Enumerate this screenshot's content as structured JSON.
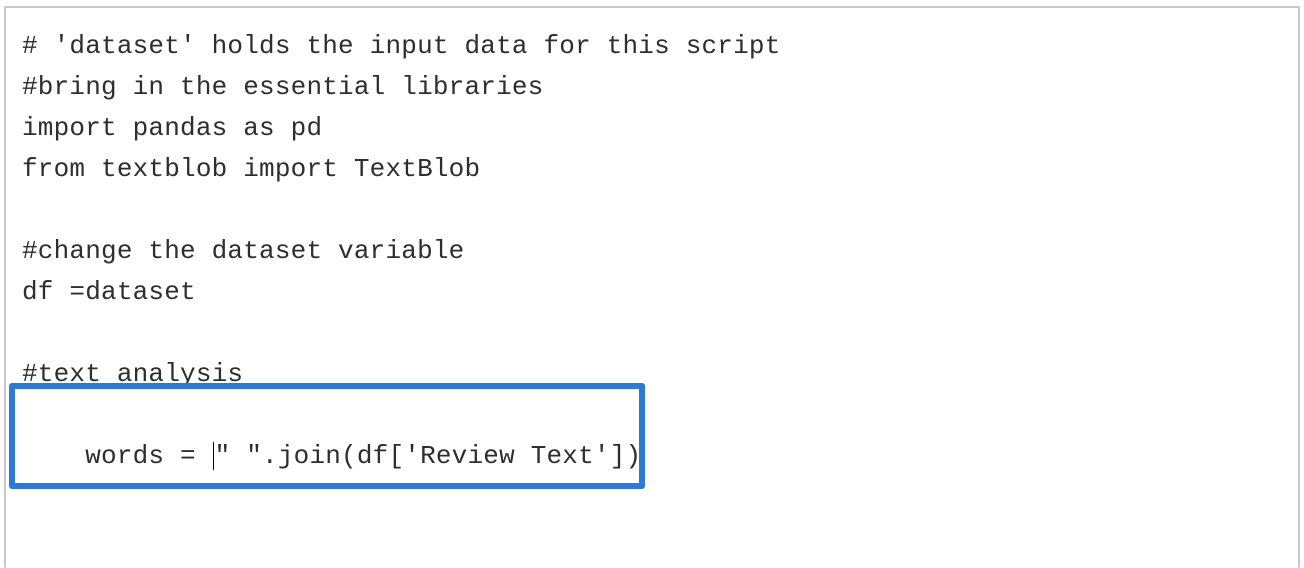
{
  "code": {
    "lines": [
      "# 'dataset' holds the input data for this script",
      "#bring in the essential libraries",
      "import pandas as pd",
      "from textblob import TextBlob",
      "",
      "#change the dataset variable",
      "df =dataset",
      "",
      "#text analysis"
    ],
    "cursor_line_pre": "words = ",
    "cursor_line_post": "\" \".join(df['Review Text'])"
  },
  "theme": {
    "border_color": "#c8c8c8",
    "highlight_color": "#2f79d6",
    "text_color": "#2e2e2e",
    "font": "Consolas"
  }
}
